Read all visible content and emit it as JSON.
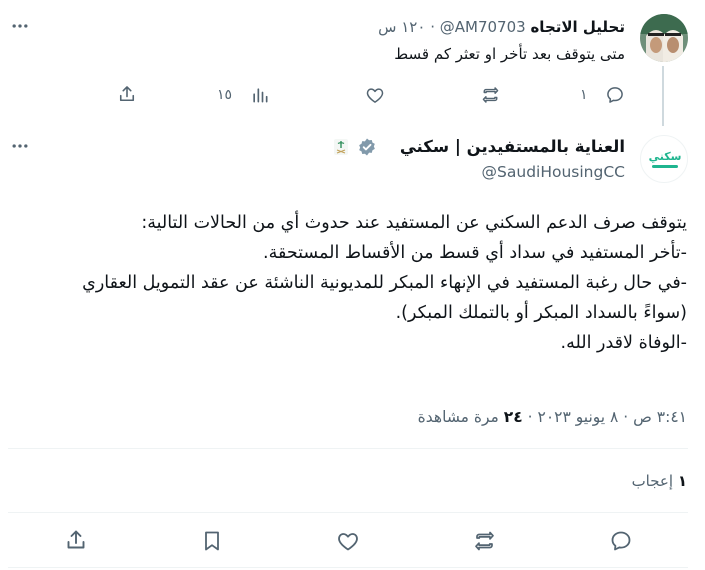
{
  "reply": {
    "display_name": "تحليل الاتجاه",
    "handle": "@AM70703",
    "time": "١٢٠ س",
    "text": "متى يتوقف بعد تأخر او تعثر كم قسط",
    "replies_count": "١",
    "views_count": "١٥"
  },
  "main_tweet": {
    "display_name": "العناية بالمستفيدين | سكني",
    "handle": "@SaudiHousingCC",
    "body_lines": [
      "يتوقف صرف الدعم السكني عن المستفيد عند حدوث أي من الحالات التالية:",
      "-تأخر المستفيد في سداد أي قسط من الأقساط المستحقة.",
      "-في حال رغبة المستفيد في الإنهاء المبكر للمديونية الناشئة عن عقد التمويل العقاري",
      "(سواءً بالسداد المبكر أو بالتملك المبكر).",
      "-الوفاة لاقدر الله."
    ],
    "timestamp": "٣:٤١ ص · ٨ يونيو ٢٠٢٣ ·",
    "views_number": "٢٤",
    "views_label": "مرة مشاهدة",
    "likes_number": "١",
    "likes_label": "إعجاب",
    "logo_text": "سكني"
  },
  "colors": {
    "text": "#0f1419",
    "muted": "#536471",
    "divider": "#eff3f4",
    "thread_line": "#cfd9de",
    "verified": "#829aab",
    "logo_green": "#1fb58f"
  }
}
